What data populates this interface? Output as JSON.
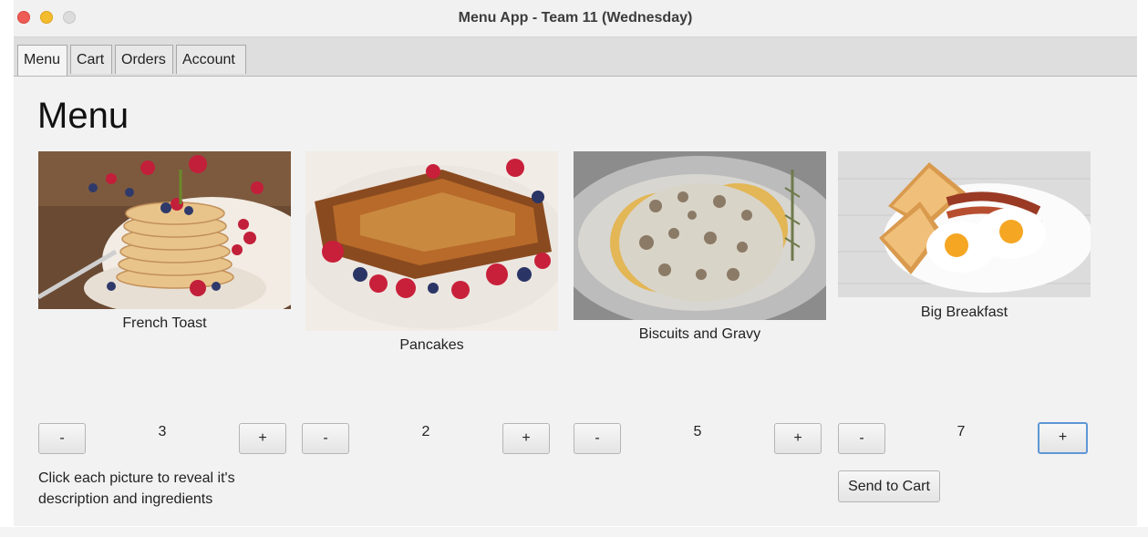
{
  "window": {
    "title": "Menu App - Team 11 (Wednesday)"
  },
  "tabs": [
    {
      "label": "Menu",
      "active": true
    },
    {
      "label": "Cart",
      "active": false
    },
    {
      "label": "Orders",
      "active": false
    },
    {
      "label": "Account",
      "active": false
    }
  ],
  "page": {
    "heading": "Menu"
  },
  "items": [
    {
      "name": "French Toast",
      "quantity": "3",
      "minus": "-",
      "plus": "+"
    },
    {
      "name": "Pancakes",
      "quantity": "2",
      "minus": "-",
      "plus": "+"
    },
    {
      "name": "Biscuits and Gravy",
      "quantity": "5",
      "minus": "-",
      "plus": "+"
    },
    {
      "name": "Big Breakfast",
      "quantity": "7",
      "minus": "-",
      "plus": "+"
    }
  ],
  "footer": {
    "hint": "Click each picture to reveal it's description and ingredients",
    "send_label": "Send to Cart"
  },
  "colors": {
    "close": "#ee5c55",
    "minimize": "#f3bc2d",
    "maximize": "#dcdcdc",
    "focus_ring": "#5e97d6"
  }
}
